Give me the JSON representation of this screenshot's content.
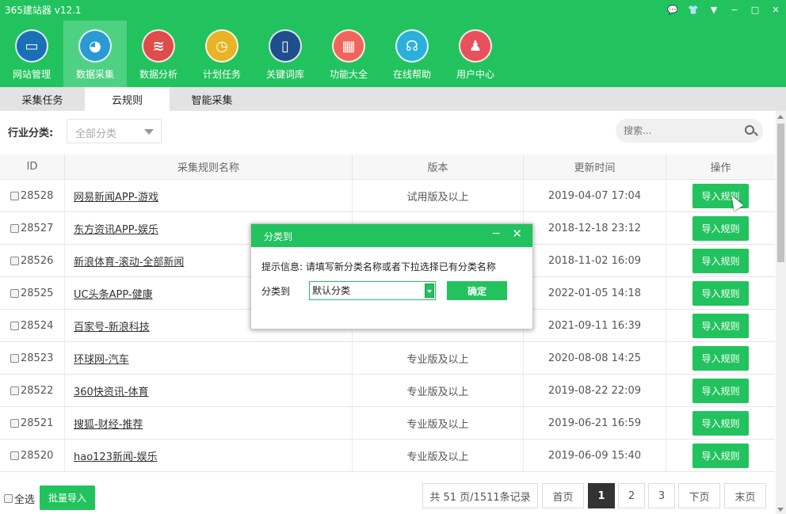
{
  "app": {
    "title": "365建站器 v12.1"
  },
  "window_controls": [
    "💬",
    "👕",
    "▼",
    "−",
    "□",
    "✕"
  ],
  "nav": {
    "items": [
      {
        "label": "网站管理",
        "icon": "monitor-icon",
        "glyph": "▭",
        "color": "#1a6fb5"
      },
      {
        "label": "数据采集",
        "icon": "globe-icon",
        "glyph": "◕",
        "color": "#2a9ad4"
      },
      {
        "label": "数据分析",
        "icon": "database-icon",
        "glyph": "≋",
        "color": "#e04b4b"
      },
      {
        "label": "计划任务",
        "icon": "clock-icon",
        "glyph": "◷",
        "color": "#e8b324"
      },
      {
        "label": "关键词库",
        "icon": "book-icon",
        "glyph": "▯",
        "color": "#1f4e8c"
      },
      {
        "label": "功能大全",
        "icon": "grid-icon",
        "glyph": "▦",
        "color": "#f0655a"
      },
      {
        "label": "在线帮助",
        "icon": "headset-icon",
        "glyph": "☊",
        "color": "#2ab0dd"
      },
      {
        "label": "用户中心",
        "icon": "user-icon",
        "glyph": "♟",
        "color": "#e8505b"
      }
    ]
  },
  "tabs": [
    "采集任务",
    "云规则",
    "智能采集"
  ],
  "filter": {
    "label": "行业分类:",
    "select_value": "全部分类",
    "search_placeholder": "搜索..."
  },
  "table": {
    "headers": [
      "ID",
      "采集规则名称",
      "版本",
      "更新时间",
      "操作"
    ],
    "rows": [
      {
        "id": "28528",
        "name": "网易新闻APP-游戏",
        "version": "试用版及以上",
        "time": "2019-04-07 17:04",
        "action": "导入规则"
      },
      {
        "id": "28527",
        "name": "东方资讯APP-娱乐",
        "version": "",
        "time": "2018-12-18 23:12",
        "action": "导入规则"
      },
      {
        "id": "28526",
        "name": "新浪体育-滚动-全部新闻",
        "version": "",
        "time": "2018-11-02 16:09",
        "action": "导入规则"
      },
      {
        "id": "28525",
        "name": "UC头条APP-健康",
        "version": "",
        "time": "2022-01-05 14:18",
        "action": "导入规则"
      },
      {
        "id": "28524",
        "name": "百家号-新浪科技",
        "version": "",
        "time": "2021-09-11 16:39",
        "action": "导入规则"
      },
      {
        "id": "28523",
        "name": "环球网-汽车",
        "version": "专业版及以上",
        "time": "2020-08-08 14:25",
        "action": "导入规则"
      },
      {
        "id": "28522",
        "name": "360快资讯-体育",
        "version": "专业版及以上",
        "time": "2019-08-22 22:09",
        "action": "导入规则"
      },
      {
        "id": "28521",
        "name": "搜狐-财经-推荐",
        "version": "专业版及以上",
        "time": "2019-06-21 16:59",
        "action": "导入规则"
      },
      {
        "id": "28520",
        "name": "hao123新闻-娱乐",
        "version": "专业版及以上",
        "time": "2019-06-09 15:40",
        "action": "导入规则"
      }
    ]
  },
  "footer": {
    "select_all": "全选",
    "batch_import": "批量导入",
    "pagination": {
      "summary": "共 51 页/1511条记录",
      "first": "首页",
      "pages": [
        "1",
        "2",
        "3"
      ],
      "current": "1",
      "next": "下页",
      "last": "末页"
    }
  },
  "dialog": {
    "title": "分类到",
    "hint": "提示信息: 请填写新分类名称或者下拉选择已有分类名称",
    "label": "分类到",
    "select_value": "默认分类",
    "confirm": "确定",
    "minimize": "−",
    "close": "✕"
  }
}
